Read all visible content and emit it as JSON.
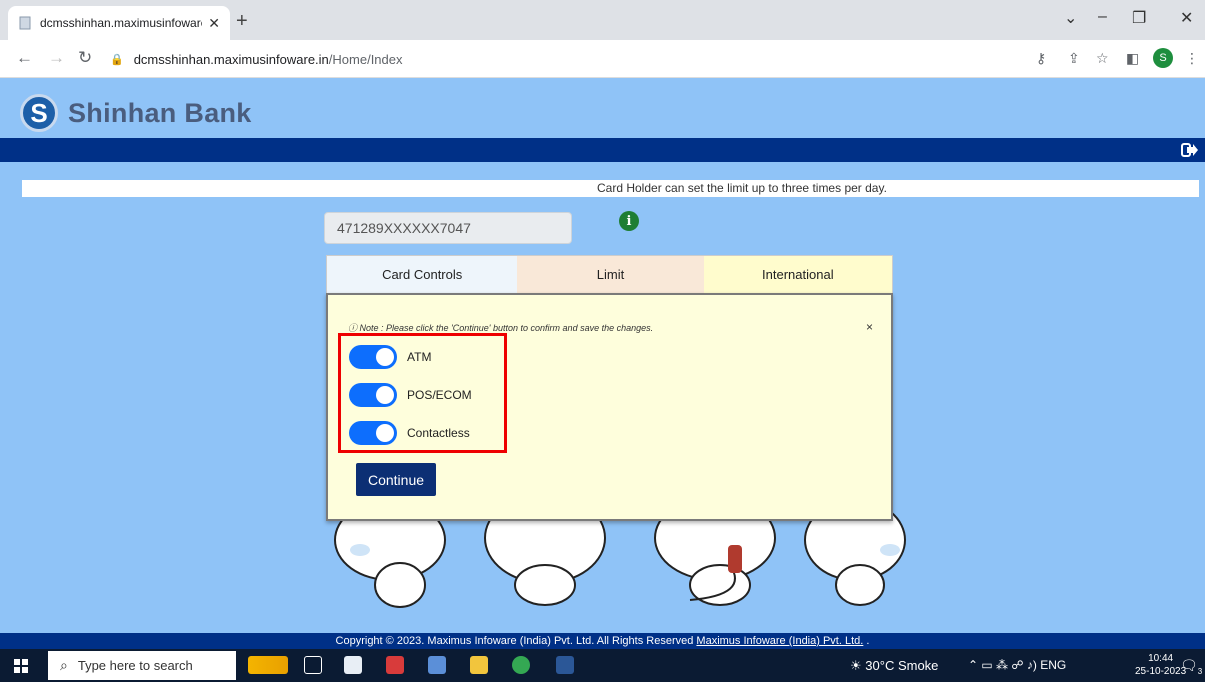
{
  "browser": {
    "tab_title": "dcmsshinhan.maximusinfoware.in",
    "url_host": "dcmsshinhan.maximusinfoware.in",
    "url_path": "/Home/Index",
    "profile_initial": "S"
  },
  "site": {
    "brand": "Shinhan Bank",
    "notice": "Card Holder can set the limit up to three times per day.",
    "card_number": "471289XXXXXX7047"
  },
  "tabs": [
    "Card Controls",
    "Limit",
    "International"
  ],
  "panel": {
    "note": "Note : Please click the 'Continue' button to confirm and save the changes.",
    "toggles": [
      {
        "label": "ATM",
        "on": true
      },
      {
        "label": "POS/ECOM",
        "on": true
      },
      {
        "label": "Contactless",
        "on": true
      }
    ],
    "continue_label": "Continue"
  },
  "footer": {
    "text": "Copyright © 2023. Maximus Infoware (India) Pvt. Ltd. All Rights Reserved",
    "link": "Maximus Infoware (India) Pvt. Ltd.",
    "suffix": " ."
  },
  "taskbar": {
    "search_placeholder": "Type here to search",
    "weather": "30°C  Smoke",
    "lang": "ENG",
    "time": "10:44",
    "date": "25-10-2023",
    "notif_count": "3"
  },
  "colors": {
    "page_bg": "#8fc3f7",
    "nav_strip": "#003087",
    "toggle_on": "#0d6efd",
    "highlight": "#ee0000",
    "continue_btn": "#0c2f74"
  }
}
